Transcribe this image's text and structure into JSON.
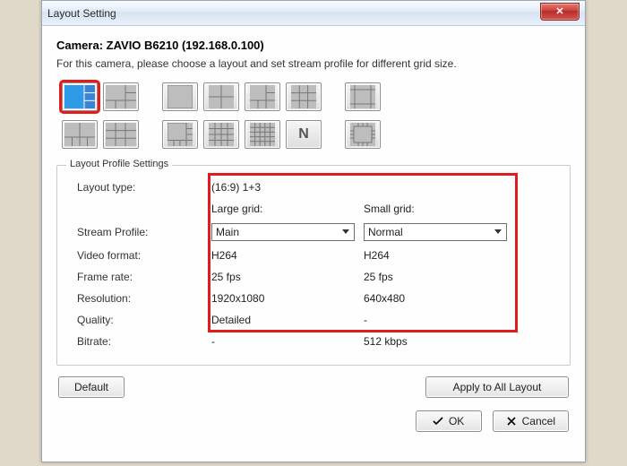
{
  "window": {
    "title": "Layout Setting"
  },
  "header": {
    "camera_label": "Camera:",
    "camera_value": "ZAVIO B6210 (192.168.0.100)",
    "instruction": "For this camera, please choose a layout and set stream profile for different grid size."
  },
  "fieldset": {
    "legend": "Layout Profile Settings"
  },
  "labels": {
    "layout_type": "Layout type:",
    "stream_profile": "Stream Profile:",
    "video_format": "Video format:",
    "frame_rate": "Frame rate:",
    "resolution": "Resolution:",
    "quality": "Quality:",
    "bitrate": "Bitrate:",
    "large_grid": "Large grid:",
    "small_grid": "Small grid:"
  },
  "values": {
    "layout_type": "(16:9) 1+3",
    "large": {
      "select": "Main",
      "video_format": "H264",
      "frame_rate": "25 fps",
      "resolution": "1920x1080",
      "quality": "Detailed",
      "bitrate": "-"
    },
    "small": {
      "select": "Normal",
      "video_format": "H264",
      "frame_rate": "25 fps",
      "resolution": "640x480",
      "quality": "-",
      "bitrate": "512 kbps"
    }
  },
  "buttons": {
    "default": "Default",
    "apply_all": "Apply to All Layout",
    "ok": "OK",
    "cancel": "Cancel"
  },
  "layout_icons": {
    "n_label": "N"
  }
}
